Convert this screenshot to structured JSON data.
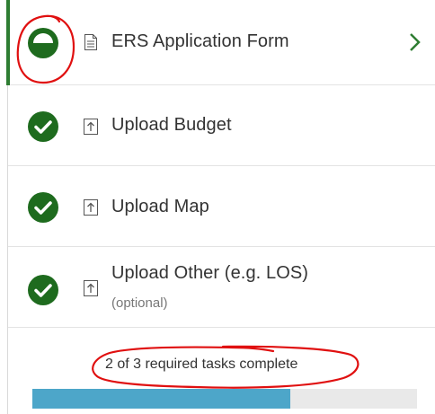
{
  "tasks": [
    {
      "label": "ERS Application Form",
      "sub": "",
      "status": "in-progress",
      "icon": "document-icon"
    },
    {
      "label": "Upload Budget",
      "sub": "",
      "status": "complete",
      "icon": "upload-icon"
    },
    {
      "label": "Upload Map",
      "sub": "",
      "status": "complete",
      "icon": "upload-icon"
    },
    {
      "label": "Upload Other (e.g. LOS)",
      "sub": "(optional)",
      "status": "complete",
      "icon": "upload-icon"
    }
  ],
  "progress": {
    "text": "2 of 3 required tasks complete",
    "fraction": 0.67
  },
  "colors": {
    "complete_green": "#1e6b1e",
    "active_bar": "#2e7d32",
    "progress_fill": "#4da6c9",
    "annotation_red": "#e01010"
  }
}
